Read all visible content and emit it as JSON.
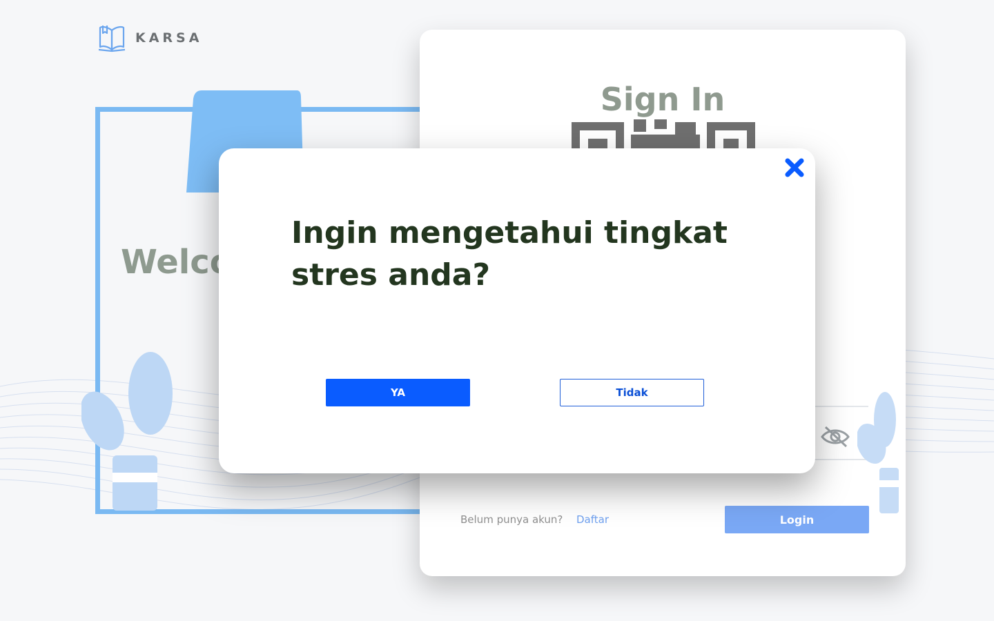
{
  "brand": {
    "name": "KARSA",
    "logo_icon": "book-icon"
  },
  "background": {
    "welcome_text": "Welco"
  },
  "signin": {
    "title": "Sign In",
    "qr_icon": "qr-code-icon",
    "password_toggle_icon": "eye-off-icon",
    "signup_prompt": "Belum punya akun?",
    "signup_link": "Daftar",
    "login_label": "Login"
  },
  "modal": {
    "title": "Ingin mengetahui tingkat stres anda?",
    "yes_label": "YA",
    "no_label": "Tidak",
    "close_icon": "close-icon"
  },
  "colors": {
    "primary": "#0a5cff",
    "modal_title": "#23361f",
    "login_button": "#7aa8f5",
    "frame": "#7ab9f2",
    "background": "#f6f7f9"
  }
}
